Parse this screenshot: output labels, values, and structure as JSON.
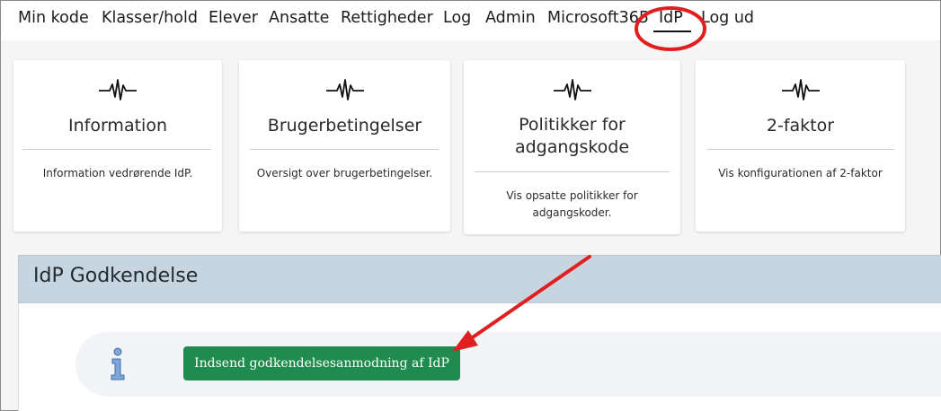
{
  "nav": {
    "items": [
      "Min kode",
      "Klasser/hold",
      "Elever",
      "Ansatte",
      "Rettigheder",
      "Log",
      "Admin",
      "Microsoft365",
      "IdP",
      "Log ud"
    ],
    "active": "IdP"
  },
  "cards": [
    {
      "icon": "pulse-icon",
      "title": "Information",
      "description": "Information vedrørende IdP."
    },
    {
      "icon": "pulse-icon",
      "title": "Brugerbetingelser",
      "description": "Oversigt over brugerbetingelser."
    },
    {
      "icon": "pulse-icon",
      "title_line1": "Politikker for",
      "title_line2": "adgangskode",
      "description_line1": "Vis opsatte politikker for",
      "description_line2": "adgangskoder."
    },
    {
      "icon": "pulse-icon",
      "title": "2-faktor",
      "description": "Vis konfigurationen af 2-faktor"
    }
  ],
  "panel": {
    "title": "IdP Godkendelse",
    "info_icon": "info-icon",
    "button_label": "Indsend godkendelsesanmodning af IdP"
  },
  "colors": {
    "button": "#1f8b4e",
    "panel_header": "#c7d5e1",
    "annotation": "#e02020"
  }
}
